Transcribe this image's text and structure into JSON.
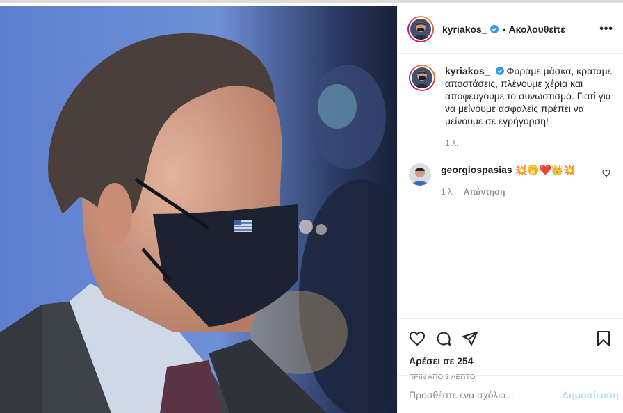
{
  "header": {
    "username": "kyriakos_",
    "dot": "•",
    "follow_label": "Ακολουθείτε",
    "more_label": "•••"
  },
  "caption": {
    "username": "kyriakos_",
    "text": "Φοράμε μάσκα, κρατάμε αποστάσεις, πλένουμε χέρια και αποφεύγουμε το συνωστισμό. Γιατί για να μείνουμε ασφαλείς πρέπει να μείνουμε σε εγρήγορση!",
    "time": "1 λ."
  },
  "comment": {
    "username": "georgiospasias",
    "text": "💥🤭❤️👑💥",
    "time": "1 λ.",
    "reply_label": "Απάντηση"
  },
  "actions": {
    "likes": "Αρέσει σε 254",
    "timestamp": "ΠΡΙΝ ΑΠΟ 1 ΛΕΠΤΟ"
  },
  "add_comment": {
    "placeholder": "Προσθέστε ένα σχόλιο...",
    "post_label": "Δημοσίευση"
  },
  "colors": {
    "verified": "#3897f0",
    "post_button_disabled": "#b2dffc"
  }
}
